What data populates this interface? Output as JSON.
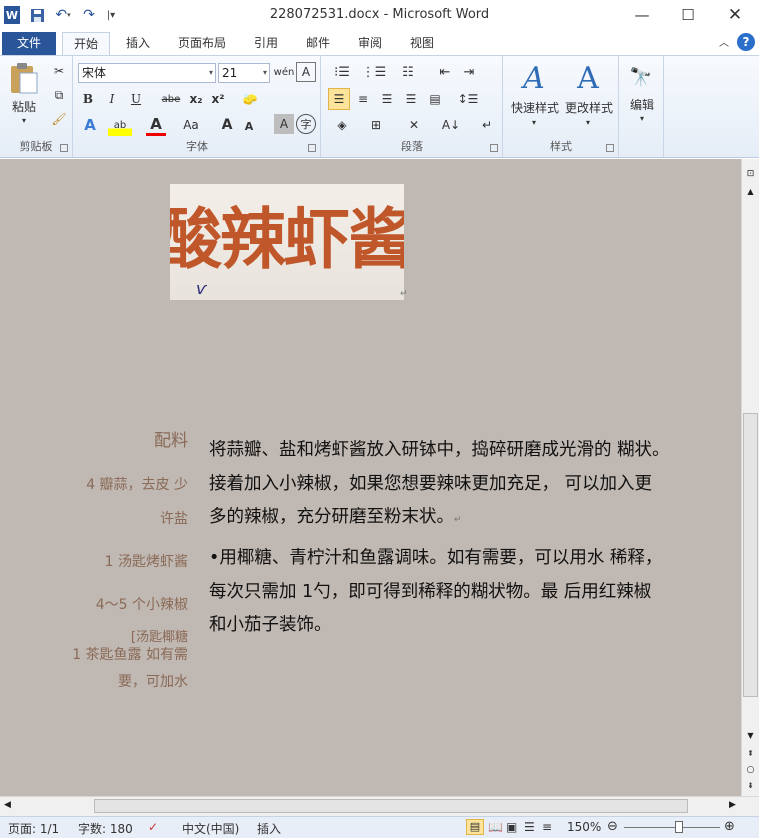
{
  "window": {
    "title": "228072531.docx - Microsoft Word"
  },
  "tabs": [
    "文件",
    "开始",
    "插入",
    "页面布局",
    "引用",
    "邮件",
    "审阅",
    "视图"
  ],
  "ribbon": {
    "clipboard": {
      "paste": "粘贴",
      "label": "剪贴板"
    },
    "font": {
      "font_name": "宋体",
      "font_size": "21",
      "label": "字体",
      "bold": "B",
      "italic": "I",
      "underline": "U",
      "strike": "abe",
      "sub": "x₂",
      "sup": "x²",
      "grow": "A",
      "shrink": "A",
      "case": "Aa",
      "char_shade": "A",
      "wen": "wén",
      "char_border": "A",
      "enclose": "字"
    },
    "paragraph": {
      "label": "段落"
    },
    "styles": {
      "quick": "快速样式",
      "change": "更改样式",
      "label": "样式"
    },
    "editing": {
      "label": "编辑"
    }
  },
  "document": {
    "hero_title": "酸辣虾酱",
    "ingredients_title": "配料",
    "ingredients": [
      "4 瓣蒜，去皮 少",
      "许盐",
      "1 汤匙烤虾酱",
      "4〜5 个小辣椒",
      "[汤匙椰糖",
      "1 茶匙鱼露  如有需",
      "要，可加水"
    ],
    "paragraph1": [
      " 将蒜瓣、盐和烤虾酱放入研钵中，捣碎研磨成光滑的 糊状。",
      "接着加入小辣椒，如果您想要辣味更加充足，  可以加入更",
      "多的辣椒，充分研磨至粉末状。"
    ],
    "paragraph2": [
      " •用椰糖、青柠汁和鱼露调味。如有需要，可以用水 稀释，",
      "每次只需加 1勺，即可得到稀释的糊状物。最 后用红辣椒",
      "和小茄子装饰。"
    ]
  },
  "status": {
    "page": "页面: 1/1",
    "words": "字数: 180",
    "language": "中文(中国)",
    "mode": "插入",
    "zoom": "150%"
  }
}
